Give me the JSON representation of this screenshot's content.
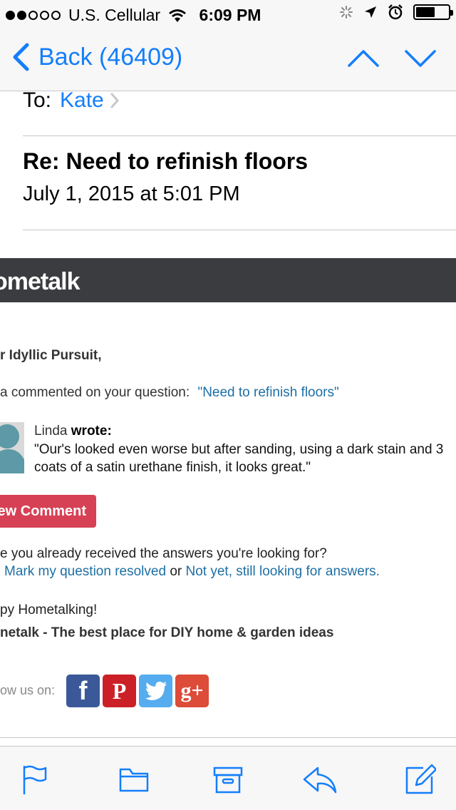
{
  "status_bar": {
    "carrier": "U.S. Cellular",
    "time": "6:09 PM",
    "signal_bars_filled": 2,
    "signal_bars_total": 5,
    "battery_level": 0.6
  },
  "nav": {
    "back_label": "Back (46409)",
    "accent_color": "#147efb",
    "icons": [
      "chevron-left-icon",
      "chevron-up-icon",
      "chevron-down-icon"
    ]
  },
  "header": {
    "to_label": "To:",
    "to_name": "Kate",
    "subject": "Re: Need to refinish floors",
    "date": "July 1, 2015 at 5:01 PM"
  },
  "email": {
    "brand": "ometalk",
    "banner_color": "#3b3c40",
    "greeting": "r Idyllic Pursuit,",
    "notice_prefix": "a commented on your question:",
    "notice_link": "\"Need to refinish floors\"",
    "comment_author": "Linda",
    "comment_wrote": "wrote:",
    "comment_text": "\"Our's looked even worse but after sanding, using a dark stain and 3 coats of a satin urethane finish, it looks great.\"",
    "view_button": "ew Comment",
    "button_color": "#d64155",
    "question_text": "e you already received the answers you're looking for?",
    "resolve_link": "Mark my question resolved",
    "or_text": "or",
    "not_yet_link": "Not yet, still looking for answers.",
    "link_color": "#1d6fa5",
    "happy_text": "py Hometalking!",
    "tagline": "netalk - The best place for DIY home & garden ideas",
    "follow_label": "ow us on:",
    "social": {
      "facebook": "f",
      "pinterest": "P",
      "twitter_icon": "twitter-bird-icon",
      "google_plus": "g+"
    }
  },
  "toolbar": {
    "icons": [
      "flag-icon",
      "folder-icon",
      "archive-icon",
      "reply-icon",
      "compose-icon"
    ]
  }
}
